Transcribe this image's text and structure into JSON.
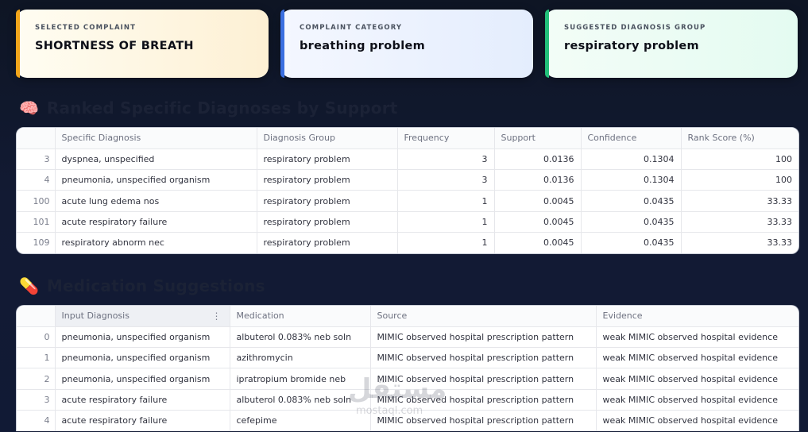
{
  "cards": [
    {
      "label": "SELECTED COMPLAINT",
      "value": "SHORTNESS OF BREATH"
    },
    {
      "label": "COMPLAINT CATEGORY",
      "value": "breathing problem"
    },
    {
      "label": "SUGGESTED DIAGNOSIS GROUP",
      "value": "respiratory problem"
    }
  ],
  "ranked_section": {
    "icon": "brain-icon",
    "icon_glyph": "🧠",
    "title": "Ranked Specific Diagnoses by Support"
  },
  "ranked_table": {
    "headers": [
      "",
      "Specific Diagnosis",
      "Diagnosis Group",
      "Frequency",
      "Support",
      "Confidence",
      "Rank Score (%)"
    ],
    "rows": [
      [
        "3",
        "dyspnea, unspecified",
        "respiratory problem",
        "3",
        "0.0136",
        "0.1304",
        "100"
      ],
      [
        "4",
        "pneumonia, unspecified organism",
        "respiratory problem",
        "3",
        "0.0136",
        "0.1304",
        "100"
      ],
      [
        "100",
        "acute lung edema nos",
        "respiratory problem",
        "1",
        "0.0045",
        "0.0435",
        "33.33"
      ],
      [
        "101",
        "acute respiratory failure",
        "respiratory problem",
        "1",
        "0.0045",
        "0.0435",
        "33.33"
      ],
      [
        "109",
        "respiratory abnorm nec",
        "respiratory problem",
        "1",
        "0.0045",
        "0.0435",
        "33.33"
      ]
    ]
  },
  "medication_section": {
    "icon": "pill-icon",
    "icon_glyph": "💊",
    "title": "Medication Suggestions"
  },
  "medication_table": {
    "headers": [
      "",
      "Input Diagnosis",
      "Medication",
      "Source",
      "Evidence"
    ],
    "column_menu_glyph": "⋮",
    "rows": [
      [
        "0",
        "pneumonia, unspecified organism",
        "albuterol 0.083% neb soln",
        "MIMIC observed hospital prescription pattern",
        "weak MIMIC observed hospital evidence"
      ],
      [
        "1",
        "pneumonia, unspecified organism",
        "azithromycin",
        "MIMIC observed hospital prescription pattern",
        "weak MIMIC observed hospital evidence"
      ],
      [
        "2",
        "pneumonia, unspecified organism",
        "ipratropium bromide neb",
        "MIMIC observed hospital prescription pattern",
        "weak MIMIC observed hospital evidence"
      ],
      [
        "3",
        "acute respiratory failure",
        "albuterol 0.083% neb soln",
        "MIMIC observed hospital prescription pattern",
        "weak MIMIC observed hospital evidence"
      ],
      [
        "4",
        "acute respiratory failure",
        "cefepime",
        "MIMIC observed hospital prescription pattern",
        "weak MIMIC observed hospital evidence"
      ]
    ]
  },
  "watermark": {
    "main": "مستقل",
    "sub": "mostaql.com"
  }
}
